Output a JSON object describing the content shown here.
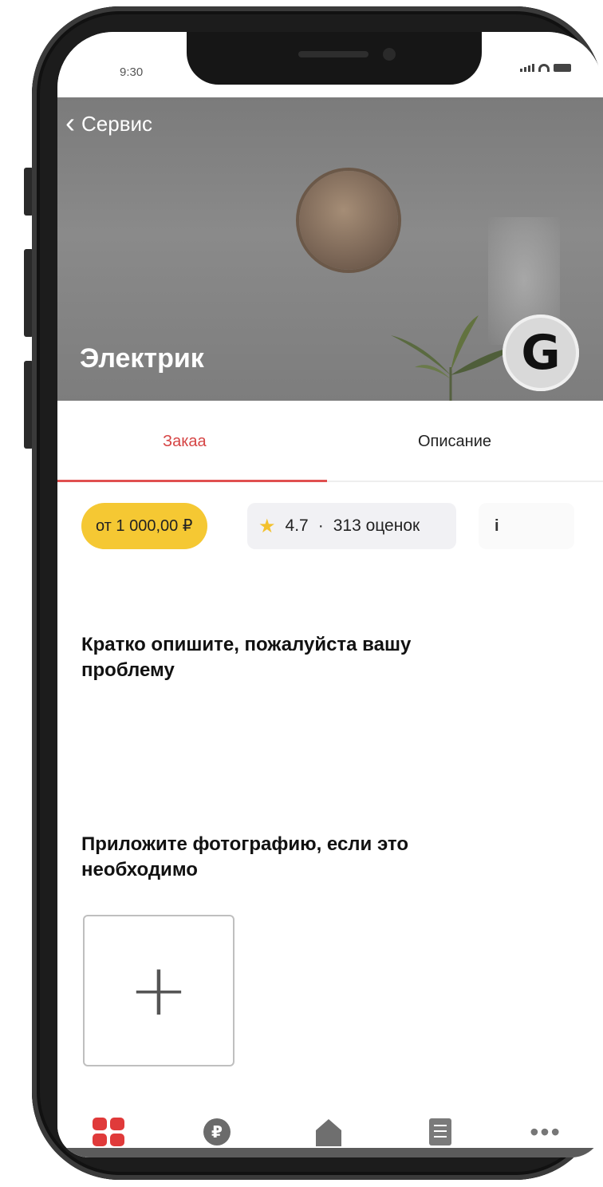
{
  "status_bar": {
    "time": "9:30"
  },
  "header": {
    "back_label": "Сервис",
    "title": "Электрик",
    "logo_letter": "G"
  },
  "tabs": [
    {
      "label": "Закаа",
      "active": true
    },
    {
      "label": "Описание",
      "active": false
    }
  ],
  "chips": {
    "price": "от 1 000,00 ₽",
    "rating": "4.7",
    "separator": "·",
    "reviews": "313 оценок",
    "info": "i"
  },
  "form": {
    "problem_prompt": "Кратко опишите, пожалуйста вашу проблему",
    "photo_prompt": "Приложите фотографию, если это необходимо",
    "add_photo_symbol": "+"
  },
  "bottom_nav": [
    {
      "id": "services",
      "icon": "grid-icon",
      "active": true
    },
    {
      "id": "payments",
      "icon": "coin-icon",
      "active": false
    },
    {
      "id": "home",
      "icon": "home-icon",
      "active": false
    },
    {
      "id": "orders",
      "icon": "document-icon",
      "active": false
    },
    {
      "id": "more",
      "icon": "more-dots-icon",
      "active": false
    }
  ],
  "colors": {
    "accent_red": "#e03a3a",
    "price_yellow": "#f5c833",
    "star_yellow": "#f3c12d"
  }
}
